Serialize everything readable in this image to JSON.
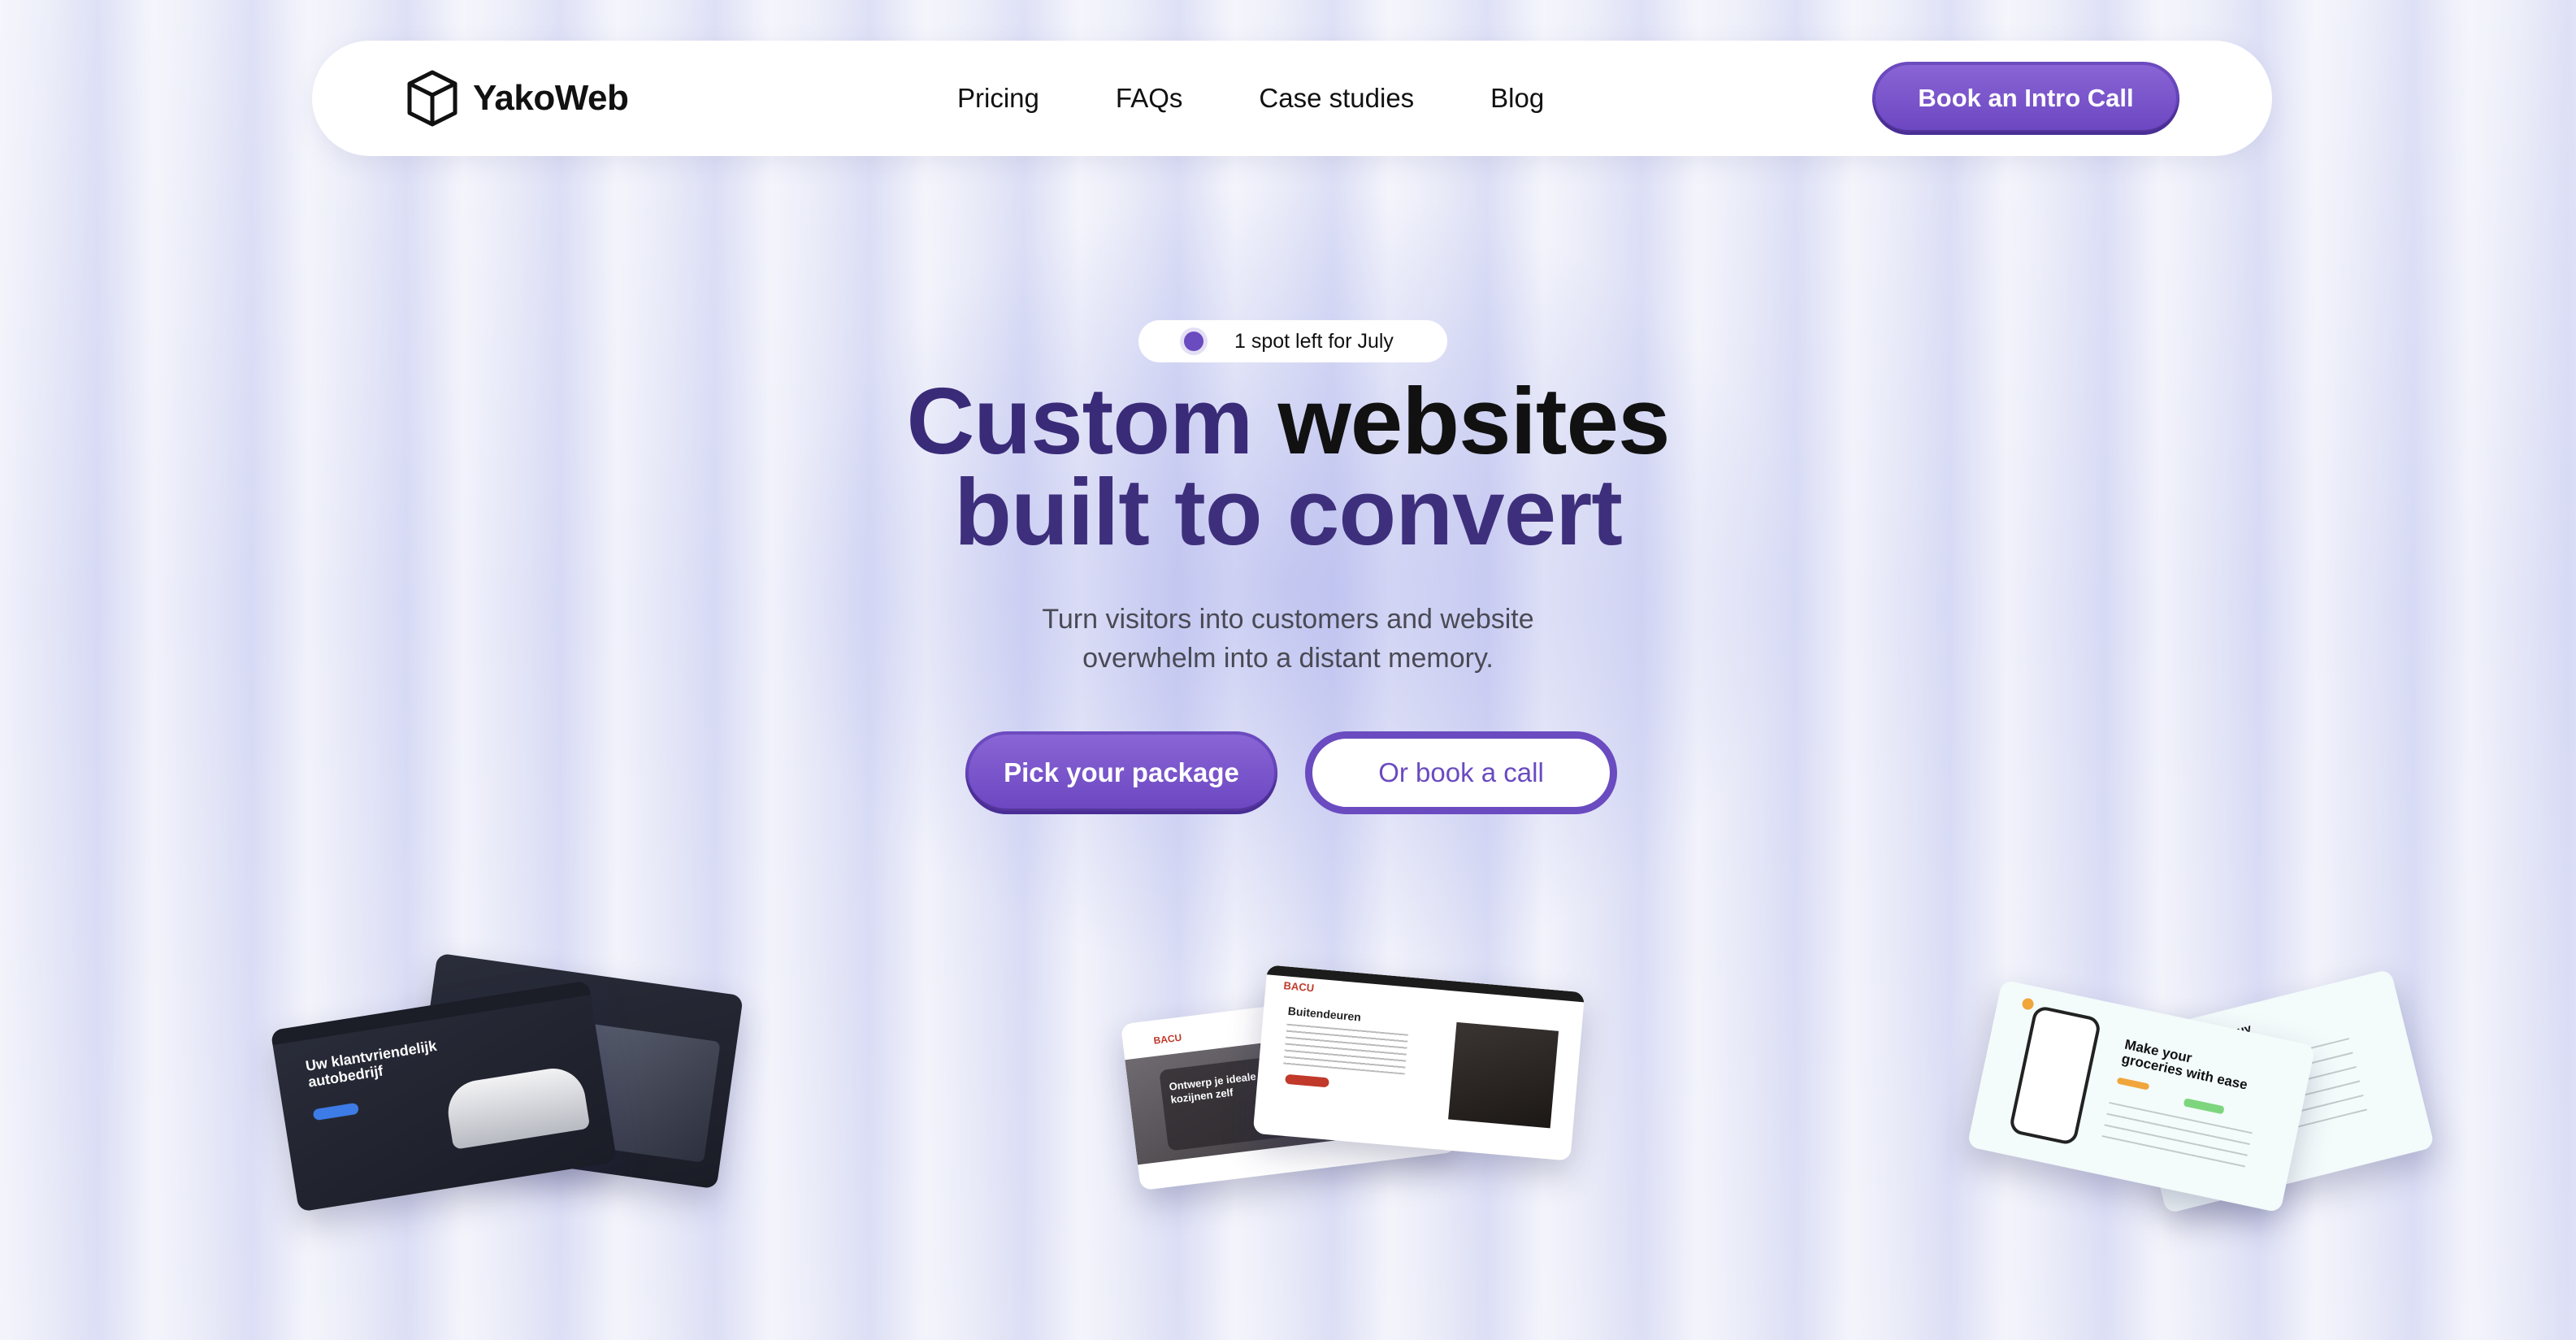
{
  "nav": {
    "brand": "YakoWeb",
    "links": [
      "Pricing",
      "FAQs",
      "Case studies",
      "Blog"
    ],
    "cta": "Book an Intro Call"
  },
  "hero": {
    "badge": "1 spot left for July",
    "headline_line1_a": "Custom",
    "headline_line1_b": "websites",
    "headline_line2": "built to convert",
    "subtitle_line1": "Turn visitors into customers and website",
    "subtitle_line2": "overwhelm into a distant memory.",
    "primary_cta": "Pick your package",
    "secondary_cta": "Or book a call"
  },
  "showcase": {
    "card1_title": "Uw klantvriendelijk autobedrijf",
    "card2_brand": "BACU",
    "card2_title": "Buitendeuren",
    "card2_overlay": "Ontwerp je ideale kozijnen zelf",
    "card3_title": "Make your groceries with ease",
    "card3_back": "ries home, buy store"
  },
  "colors": {
    "accent": "#6a4bc0",
    "accent_light": "#8a66d6",
    "background": "#e4e6f7"
  }
}
